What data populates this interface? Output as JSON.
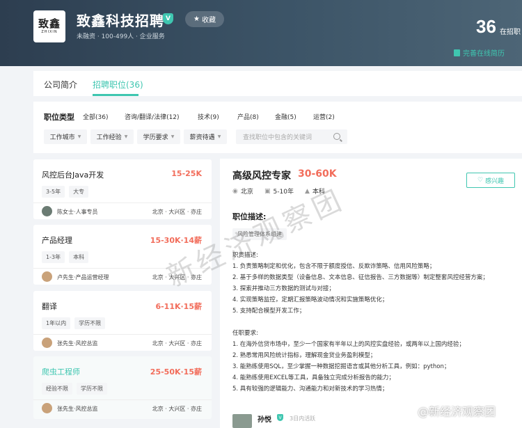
{
  "company": {
    "logo_mark": "致鑫",
    "logo_sub": "ZHIXIN",
    "name": "致鑫科技招聘",
    "verified_mark": "V",
    "collect_label": "收藏",
    "meta": "未融资 · 100-499人 · 企业服务",
    "open_count": "36",
    "open_count_label": "在招职",
    "resume_link": "完善在线简历"
  },
  "tabs": [
    {
      "label": "公司简介",
      "active": false
    },
    {
      "label": "招聘职位(36)",
      "active": true
    }
  ],
  "filters": {
    "title": "职位类型",
    "categories": [
      "全部(36)",
      "咨询/翻译/法律(12)",
      "技术(9)",
      "产品(8)",
      "金融(5)",
      "运营(2)"
    ],
    "dropdowns": [
      "工作城市",
      "工作经验",
      "学历要求",
      "薪资待遇"
    ],
    "search_placeholder": "查找职位中包含的关键词"
  },
  "jobs": [
    {
      "title": "风控后台Java开发",
      "salary": "15-25K",
      "tags": [
        "3-5年",
        "大专"
      ],
      "recruiter": "陈女士·人事专员",
      "location": "北京 · 大兴区 · 亦庄"
    },
    {
      "title": "产品经理",
      "salary": "15-30K·14薪",
      "tags": [
        "1-3年",
        "本科"
      ],
      "recruiter": "卢先生·产品运营经理",
      "location": "北京 · 大兴区 · 亦庄"
    },
    {
      "title": "翻译",
      "salary": "6-11K·15薪",
      "tags": [
        "1年以内",
        "学历不限"
      ],
      "recruiter": "张先生·风控总监",
      "location": "北京 · 大兴区 · 亦庄"
    },
    {
      "title": "爬虫工程师",
      "salary": "25-50K·15薪",
      "tags": [
        "经验不限",
        "学历不限"
      ],
      "recruiter": "张先生·风控总监",
      "location": "北京 · 大兴区 · 亦庄"
    }
  ],
  "detail": {
    "title": "高级风控专家",
    "salary": "30-60K",
    "interest_label": "感兴趣",
    "city": "北京",
    "experience": "5-10年",
    "education": "本科",
    "section_title": "职位描述:",
    "dept_tag": "风险管理体系组建",
    "duties_title": "职责描述:",
    "duties": [
      "1. 负责策略制定和优化，包含不限于额度授信、反欺诈策略、信用风险策略；",
      "2. 基于多样的数据类型（设备信息、文本信息、征信报告、三方数据等）制定整套风控经营方案；",
      "3. 探索并推动三方数据的测试与对接；",
      "4. 实现策略监控，定期汇报策略波动情况和实施策略优化；",
      "5. 支持配合模型开发工作；"
    ],
    "requirements_title": "任职要求:",
    "requirements": [
      "1. 在海外信贷市场中，至少一个国家有半年以上的风控实盘经验，或两年以上国内经验；",
      "2. 熟悉常用风险统计指标，理解现金贷业务盈利模型；",
      "3. 能熟练使用SQL，至少掌握一种数据挖掘语言或其他分析工具，例如：python；",
      "4. 能熟练使用EXCEL等工具，具备独立完成分析报告的能力；",
      "5. 具有较强的逻辑能力、沟通能力和对新技术的学习热情；"
    ],
    "hr_name": "孙悦",
    "hr_active": "3日内活跃"
  },
  "watermarks": {
    "center": "新经济观察团",
    "corner": "@新经济观察团"
  }
}
